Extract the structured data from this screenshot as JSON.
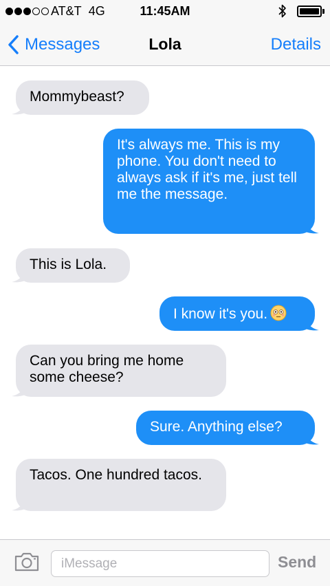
{
  "status_bar": {
    "carrier": "AT&T",
    "network": "4G",
    "time": "11:45AM",
    "signal_bars": 3,
    "signal_total": 5,
    "battery_level": 1.0
  },
  "nav": {
    "back_label": "Messages",
    "title": "Lola",
    "details_label": "Details"
  },
  "messages": [
    {
      "from": "them",
      "text": "Mommybeast?"
    },
    {
      "from": "me",
      "text": "It's always me. This is my phone. You don't need to always ask if it's me, just tell me the message."
    },
    {
      "from": "them",
      "text": "This is Lola."
    },
    {
      "from": "me",
      "text": "I know it's you.",
      "emoji": "flushed-face-emoji"
    },
    {
      "from": "them",
      "text": "Can you bring me home some cheese?"
    },
    {
      "from": "me",
      "text": "Sure. Anything else?"
    },
    {
      "from": "them",
      "text": "Tacos. One hundred tacos."
    }
  ],
  "composer": {
    "placeholder": "iMessage",
    "value": "",
    "send_label": "Send",
    "camera_icon": "camera-icon"
  },
  "colors": {
    "sent_bubble": "#1e8ff7",
    "received_bubble": "#e5e5ea",
    "accent": "#157efb",
    "send_disabled": "#8e8e93"
  }
}
